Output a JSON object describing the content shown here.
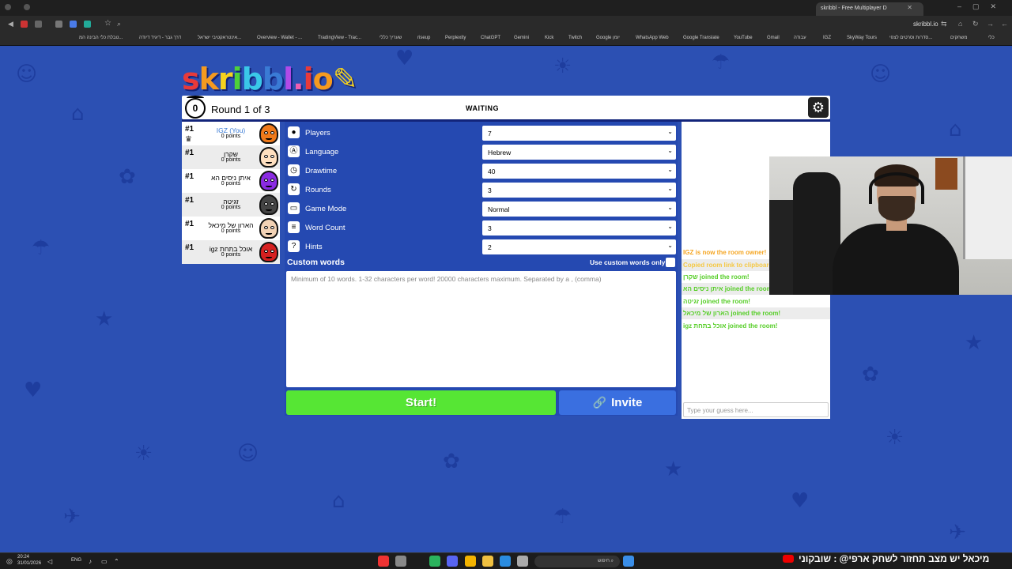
{
  "browser": {
    "tab_title": "skribbl - Free Multiplayer D",
    "url": "skribbl.io",
    "bookmarks": [
      "כלי",
      "משחקים",
      "סדרות וסרטים לצפי...",
      "SkyWay Tours",
      "IGZ",
      "עבודה",
      "Gmail",
      "YouTube",
      "Google Translate",
      "WhatsApp Web",
      "Google יומן",
      "Twitch",
      "Kick",
      "Gemini",
      "ChatGPT",
      "Perplexity",
      "riseup",
      "שעריך כללי",
      "TradingView - Trac...",
      "Overview - Wallet - ...",
      "אינטראקטיבי ישראל...",
      "דרך גבר - דיגיד דיודה",
      "טבלת כלי הבינה המ..."
    ]
  },
  "logo": {
    "text": "skribbl.io"
  },
  "game": {
    "timer": "0",
    "round_label": "Round 1 of 3",
    "status": "WAITING",
    "settings_icon": "gear-icon"
  },
  "players": [
    {
      "rank": "#1",
      "name": "IGZ (You)",
      "points": "0 points",
      "is_you": true,
      "color": "#f07a1a"
    },
    {
      "rank": "#1",
      "name": "שקרן",
      "points": "0 points",
      "is_you": false,
      "color": "#ffe0c0"
    },
    {
      "rank": "#1",
      "name": "איתן ניסים הא",
      "points": "0 points",
      "is_you": false,
      "color": "#8a2be2"
    },
    {
      "rank": "#1",
      "name": "זגיטה",
      "points": "0 points",
      "is_you": false,
      "color": "#444444"
    },
    {
      "rank": "#1",
      "name": "הארון של מיכאל",
      "points": "0 points",
      "is_you": false,
      "color": "#f2d2b5"
    },
    {
      "rank": "#1",
      "name": "igz אוכל בתחת",
      "points": "0 points",
      "is_you": false,
      "color": "#d62020"
    }
  ],
  "settings": [
    {
      "label": "Players",
      "value": "7",
      "icon": "user-icon"
    },
    {
      "label": "Language",
      "value": "Hebrew",
      "icon": "language-icon"
    },
    {
      "label": "Drawtime",
      "value": "40",
      "icon": "timer-icon"
    },
    {
      "label": "Rounds",
      "value": "3",
      "icon": "rounds-icon"
    },
    {
      "label": "Game Mode",
      "value": "Normal",
      "icon": "gamemode-icon"
    },
    {
      "label": "Word Count",
      "value": "3",
      "icon": "wordcount-icon"
    },
    {
      "label": "Hints",
      "value": "2",
      "icon": "hint-icon"
    }
  ],
  "custom_words": {
    "label": "Custom words",
    "only_label": "Use custom words only",
    "placeholder": "Minimum of 10 words. 1-32 characters per word! 20000 characters maximum. Separated by a , (comma)"
  },
  "buttons": {
    "start": "Start!",
    "invite": "Invite"
  },
  "chat": {
    "messages": [
      {
        "text": "IGZ is now the room owner!",
        "color": "#f5a623"
      },
      {
        "text": "Copied room link to clipboard!",
        "color": "#f5c842"
      },
      {
        "text": "שקרן joined the room!",
        "color": "#56ce27"
      },
      {
        "text": "איתן ניסים הא joined the room!",
        "color": "#56ce27"
      },
      {
        "text": "זגיטה joined the room!",
        "color": "#56ce27"
      },
      {
        "text": "הארון של מיכאל joined the room!",
        "color": "#56ce27"
      },
      {
        "text": "igz אוכל בתחת joined the room!",
        "color": "#56ce27"
      }
    ],
    "guess_placeholder": "Type your guess here..."
  },
  "taskbar": {
    "time": "20:24",
    "date": "31/01/2026",
    "lang": "ENG",
    "search_placeholder": "חיפוש",
    "ticker": "מיכאל יש מצב תחזור לשחק ארפי@ : שובקוני"
  }
}
